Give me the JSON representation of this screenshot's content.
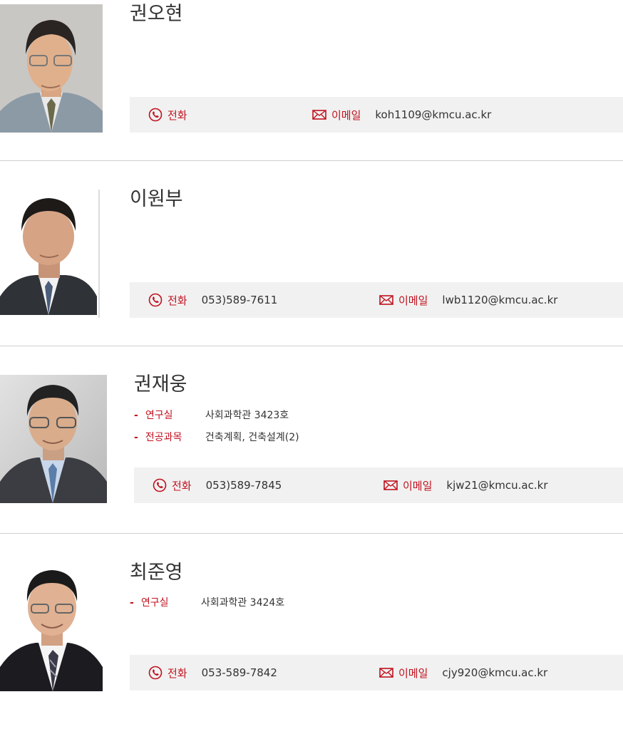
{
  "colors": {
    "accent": "#c1121f",
    "contact_bg": "#f1f1f1",
    "separator": "#cfcfcf"
  },
  "icons": {
    "phone": "phone-icon",
    "email": "mail-icon"
  },
  "professors": [
    {
      "name": "권오현",
      "details": [],
      "phone_label": "전화",
      "phone": "",
      "email_label": "이메일",
      "email": "koh1109@kmcu.ac.kr"
    },
    {
      "name": "이원부",
      "details": [],
      "phone_label": "전화",
      "phone": "053)589-7611",
      "email_label": "이메일",
      "email": "lwb1120@kmcu.ac.kr"
    },
    {
      "name": "권재웅",
      "details": [
        {
          "label": "연구실",
          "value": "사회과학관 3423호"
        },
        {
          "label": "전공과목",
          "value": "건축계획, 건축설계(2)"
        }
      ],
      "phone_label": "전화",
      "phone": "053)589-7845",
      "email_label": "이메일",
      "email": "kjw21@kmcu.ac.kr"
    },
    {
      "name": "최준영",
      "details": [
        {
          "label": "연구실",
          "value": "사회과학관 3424호"
        }
      ],
      "phone_label": "전화",
      "phone": "053-589-7842",
      "email_label": "이메일",
      "email": "cjy920@kmcu.ac.kr"
    }
  ]
}
